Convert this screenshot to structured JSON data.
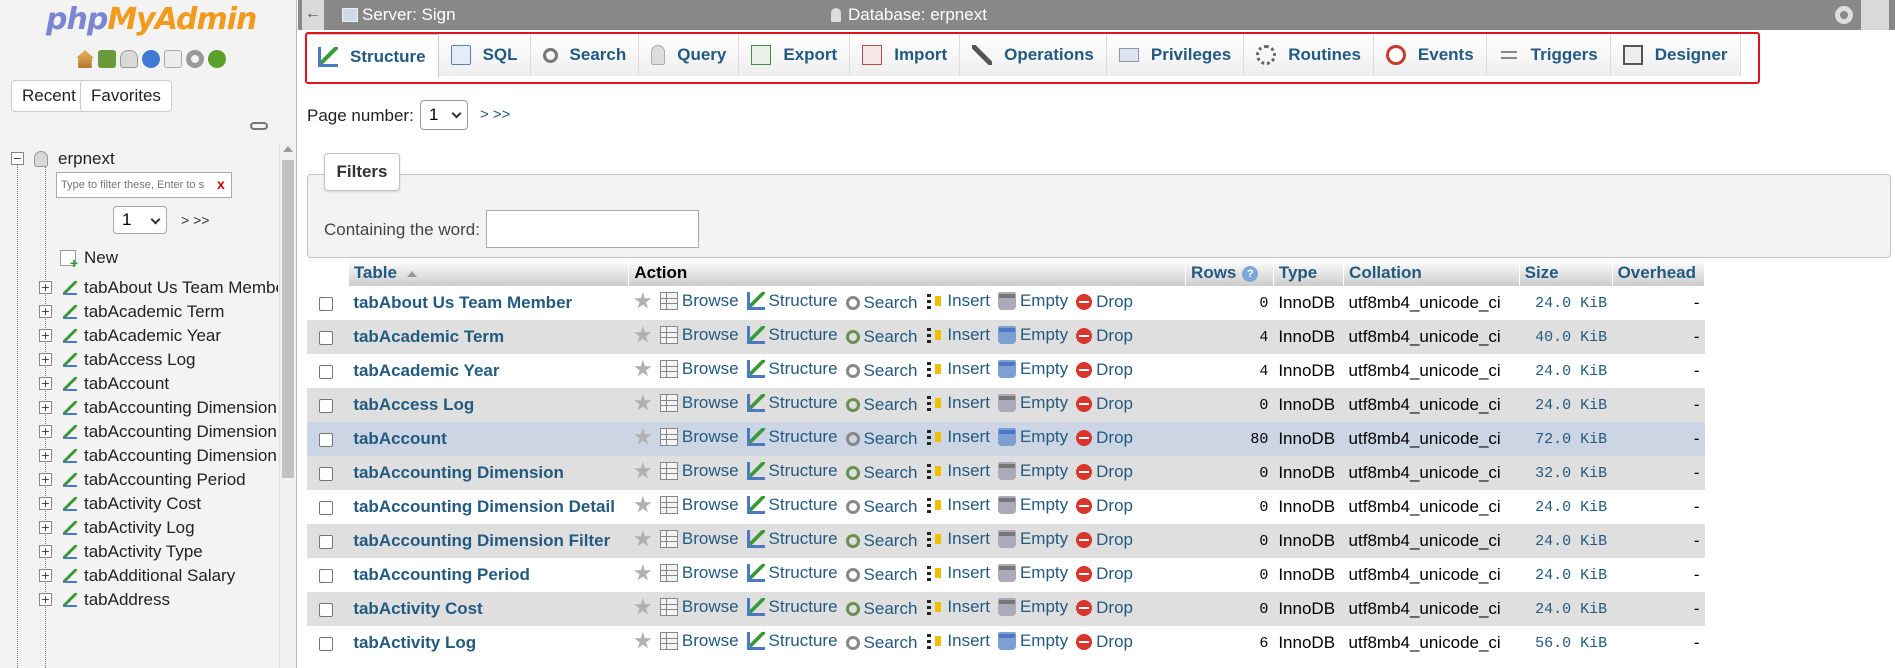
{
  "nav": {
    "logo_php": "php",
    "logo_my": "My",
    "logo_admin": "Admin",
    "icons": [
      "home-icon",
      "logout-icon",
      "database-icon",
      "help-icon",
      "docs-icon",
      "settings-icon",
      "reload-icon"
    ],
    "recent_label": "Recent",
    "favorites_label": "Favorites",
    "db_name": "erpnext",
    "filter_placeholder": "Type to filter these, Enter to s",
    "filter_clear": "x",
    "page_value": "1",
    "page_nav": "> >>",
    "new_label": "New",
    "tables": [
      "tabAbout Us Team Membe",
      "tabAcademic Term",
      "tabAcademic Year",
      "tabAccess Log",
      "tabAccount",
      "tabAccounting Dimension",
      "tabAccounting Dimension I",
      "tabAccounting Dimension I",
      "tabAccounting Period",
      "tabActivity Cost",
      "tabActivity Log",
      "tabActivity Type",
      "tabAdditional Salary",
      "tabAddress"
    ]
  },
  "topbar": {
    "server_label": "Server: Sign",
    "database_label": "Database: erpnext"
  },
  "tabs": [
    {
      "label": "Structure",
      "icon": "structure-icon",
      "active": true
    },
    {
      "label": "SQL",
      "icon": "sql-icon"
    },
    {
      "label": "Search",
      "icon": "search-icon"
    },
    {
      "label": "Query",
      "icon": "query-icon"
    },
    {
      "label": "Export",
      "icon": "export-icon"
    },
    {
      "label": "Import",
      "icon": "import-icon"
    },
    {
      "label": "Operations",
      "icon": "operations-icon"
    },
    {
      "label": "Privileges",
      "icon": "privileges-icon"
    },
    {
      "label": "Routines",
      "icon": "routines-icon"
    },
    {
      "label": "Events",
      "icon": "events-icon"
    },
    {
      "label": "Triggers",
      "icon": "triggers-icon"
    },
    {
      "label": "Designer",
      "icon": "designer-icon"
    }
  ],
  "highlight_color": "#e0141e",
  "main": {
    "page_label": "Page number:",
    "page_value": "1",
    "page_nav": "> >>",
    "filters_title": "Filters",
    "filter_label": "Containing the word:",
    "filter_value": ""
  },
  "table": {
    "headers": {
      "table": "Table",
      "action": "Action",
      "rows": "Rows",
      "rows_help": "?",
      "type": "Type",
      "collation": "Collation",
      "size": "Size",
      "overhead": "Overhead"
    },
    "actions": {
      "browse": "Browse",
      "structure": "Structure",
      "search": "Search",
      "insert": "Insert",
      "empty": "Empty",
      "drop": "Drop"
    },
    "rows": [
      {
        "name": "tabAbout Us Team Member",
        "rows": "0",
        "type": "InnoDB",
        "collation": "utf8mb4_unicode_ci",
        "size": "24.0 KiB",
        "overhead": "-"
      },
      {
        "name": "tabAcademic Term",
        "rows": "4",
        "type": "InnoDB",
        "collation": "utf8mb4_unicode_ci",
        "size": "40.0 KiB",
        "overhead": "-"
      },
      {
        "name": "tabAcademic Year",
        "rows": "4",
        "type": "InnoDB",
        "collation": "utf8mb4_unicode_ci",
        "size": "24.0 KiB",
        "overhead": "-"
      },
      {
        "name": "tabAccess Log",
        "rows": "0",
        "type": "InnoDB",
        "collation": "utf8mb4_unicode_ci",
        "size": "24.0 KiB",
        "overhead": "-"
      },
      {
        "name": "tabAccount",
        "rows": "80",
        "type": "InnoDB",
        "collation": "utf8mb4_unicode_ci",
        "size": "72.0 KiB",
        "overhead": "-",
        "highlighted": true
      },
      {
        "name": "tabAccounting Dimension",
        "rows": "0",
        "type": "InnoDB",
        "collation": "utf8mb4_unicode_ci",
        "size": "32.0 KiB",
        "overhead": "-"
      },
      {
        "name": "tabAccounting Dimension Detail",
        "rows": "0",
        "type": "InnoDB",
        "collation": "utf8mb4_unicode_ci",
        "size": "24.0 KiB",
        "overhead": "-"
      },
      {
        "name": "tabAccounting Dimension Filter",
        "rows": "0",
        "type": "InnoDB",
        "collation": "utf8mb4_unicode_ci",
        "size": "24.0 KiB",
        "overhead": "-"
      },
      {
        "name": "tabAccounting Period",
        "rows": "0",
        "type": "InnoDB",
        "collation": "utf8mb4_unicode_ci",
        "size": "24.0 KiB",
        "overhead": "-"
      },
      {
        "name": "tabActivity Cost",
        "rows": "0",
        "type": "InnoDB",
        "collation": "utf8mb4_unicode_ci",
        "size": "24.0 KiB",
        "overhead": "-"
      },
      {
        "name": "tabActivity Log",
        "rows": "6",
        "type": "InnoDB",
        "collation": "utf8mb4_unicode_ci",
        "size": "56.0 KiB",
        "overhead": "-"
      }
    ]
  }
}
